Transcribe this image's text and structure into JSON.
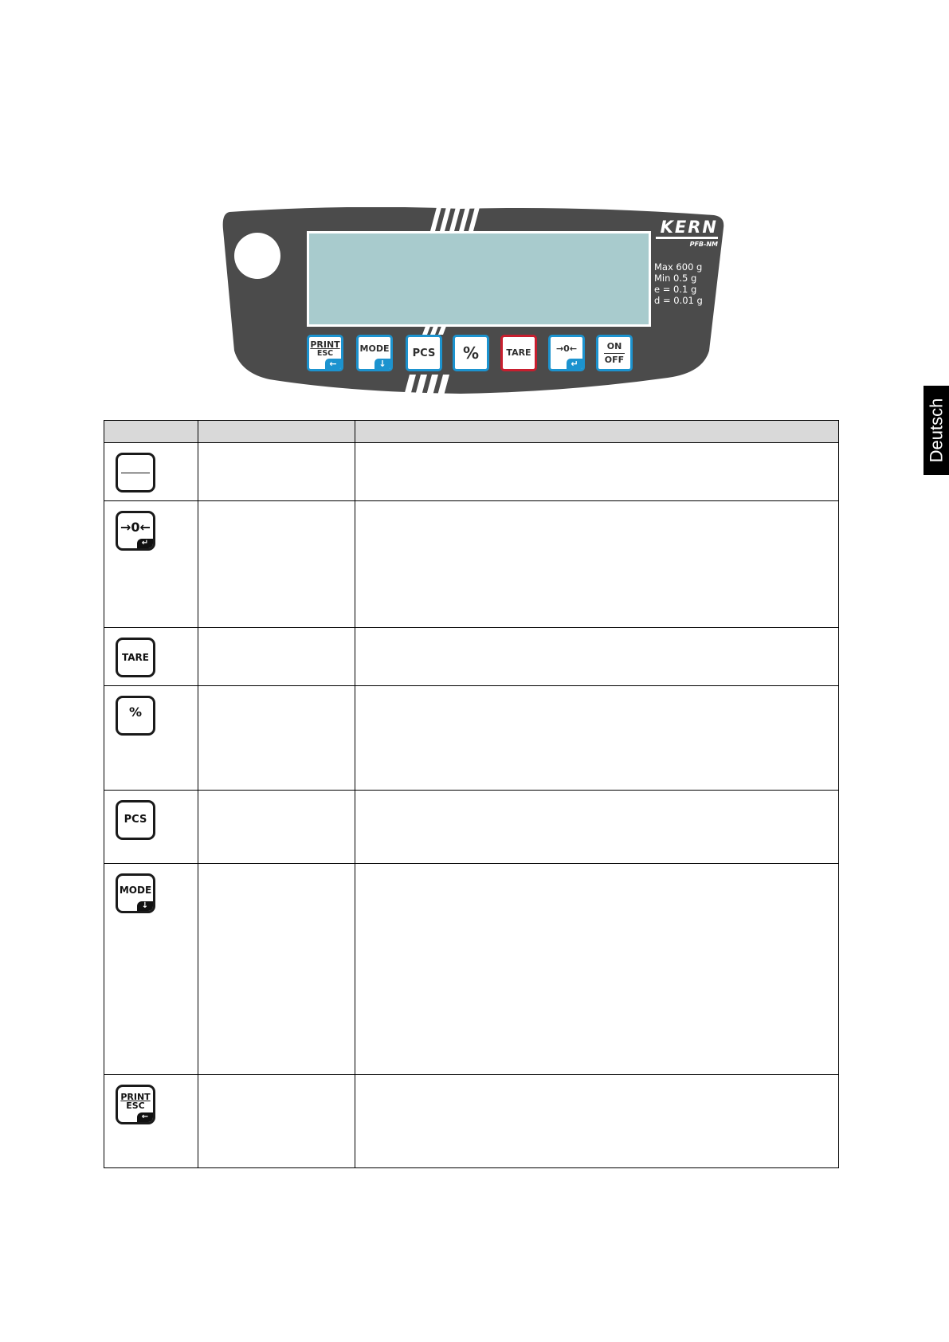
{
  "panel": {
    "brand": "KERN",
    "model": "PFB-NM",
    "specs": [
      "Max 600 g",
      "Min 0.5 g",
      "e = 0.1 g",
      "d = 0.01 g"
    ],
    "keys": [
      {
        "name": "print-esc",
        "line1": "PRINT",
        "line2": "ESC",
        "corner": "←"
      },
      {
        "name": "mode",
        "line1": "MODE",
        "corner": "↓"
      },
      {
        "name": "pcs",
        "line1": "PCS"
      },
      {
        "name": "percent",
        "line1": "%"
      },
      {
        "name": "tare",
        "line1": "TARE",
        "accent": "#c81e2e"
      },
      {
        "name": "zero",
        "line1": "→0←",
        "corner": "↵"
      },
      {
        "name": "on-off",
        "line1": "ON",
        "line2": "OFF"
      }
    ],
    "colors": {
      "body": "#4b4b4b",
      "lcd": "#a8cbcd",
      "key_border": "#1c93cf",
      "tare_border": "#c81e2e"
    }
  },
  "table": {
    "headers": [
      "",
      "",
      ""
    ],
    "rows": [
      {
        "icon": "onoff-key-icon",
        "label_top": "",
        "label_bottom": "",
        "col2": "",
        "col3": ""
      },
      {
        "icon": "zero-key-icon",
        "label": "→0←",
        "corner": "↵",
        "col2": "",
        "col3": ""
      },
      {
        "icon": "tare-key-icon",
        "label": "TARE",
        "col2": "",
        "col3": ""
      },
      {
        "icon": "percent-key-icon",
        "label": "%",
        "col2": "",
        "col3": ""
      },
      {
        "icon": "pcs-key-icon",
        "label": "PCS",
        "col2": "",
        "col3": ""
      },
      {
        "icon": "mode-key-icon",
        "label": "MODE",
        "corner": "↓",
        "col2": "",
        "col3": ""
      },
      {
        "icon": "print-esc-key-icon",
        "label_top": "PRINT",
        "label_bottom": "ESC",
        "corner": "←",
        "col2": "",
        "col3": ""
      }
    ]
  },
  "side_tab": "Deutsch"
}
